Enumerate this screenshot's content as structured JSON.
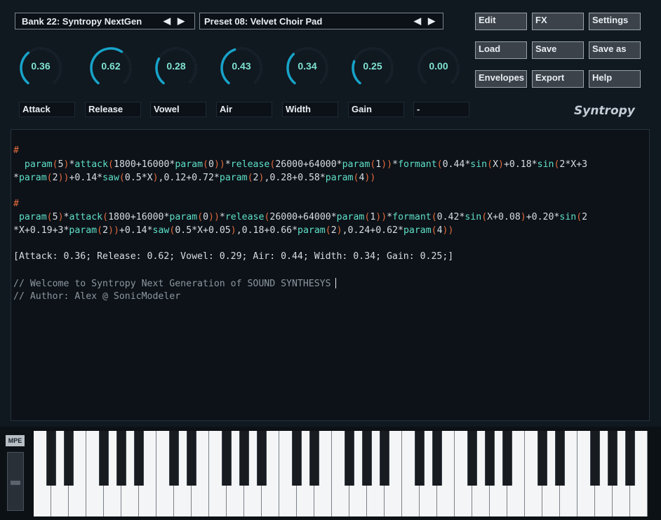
{
  "bank": {
    "label": "Bank 22: Syntropy NextGen"
  },
  "preset": {
    "label": "Preset 08: Velvet Choir Pad"
  },
  "arrows": {
    "prev": "◀",
    "next": "▶"
  },
  "buttons": [
    {
      "label": "Edit"
    },
    {
      "label": "FX"
    },
    {
      "label": "Settings"
    },
    {
      "label": "Load"
    },
    {
      "label": "Save"
    },
    {
      "label": "Save as"
    },
    {
      "label": "Envelopes"
    },
    {
      "label": "Export"
    },
    {
      "label": "Help"
    }
  ],
  "knobs": [
    {
      "value": "0.36",
      "level": 0.36,
      "label": "Attack"
    },
    {
      "value": "0.62",
      "level": 0.62,
      "label": "Release"
    },
    {
      "value": "0.28",
      "level": 0.28,
      "label": "Vowel"
    },
    {
      "value": "0.43",
      "level": 0.43,
      "label": "Air"
    },
    {
      "value": "0.34",
      "level": 0.34,
      "label": "Width"
    },
    {
      "value": "0.25",
      "level": 0.25,
      "label": "Gain"
    },
    {
      "value": "0.00",
      "level": 0.0,
      "label": "-"
    }
  ],
  "brand": "Syntropy",
  "editor": {
    "hash": "#",
    "l2a": "  param(5)*attack(1800+16000*param(0))*release(26000+64000*param(1))*formant(0.44*sin(X)+0.18*sin(2*X+3",
    "l2b": "*param(2))+0.14*saw(0.5*X),0.12+0.72*param(2),0.28+0.58*param(4))",
    "l3a": " param(5)*attack(1800+16000*param(0))*release(26000+64000*param(1))*formant(0.42*sin(X+0.08)+0.20*sin(2",
    "l3b": "*X+0.19+3*param(2))+0.14*saw(0.5*X+0.05),0.18+0.66*param(2),0.24+0.62*param(4))",
    "summary": "[Attack: 0.36; Release: 0.62; Vowel: 0.29; Air: 0.44; Width: 0.34; Gain: 0.25;]",
    "comment1": "// Welcome to Syntropy Next Generation of SOUND SYNTHESYS",
    "comment2": "// Author: Alex @ SonicModeler"
  },
  "keyboard": {
    "mpe_label": "MPE",
    "white_keys": 35
  },
  "colors": {
    "accent": "#7fe3d2",
    "arc": "#17a3c9",
    "hash": "#e36a3e",
    "function": "#5fe0c8"
  }
}
